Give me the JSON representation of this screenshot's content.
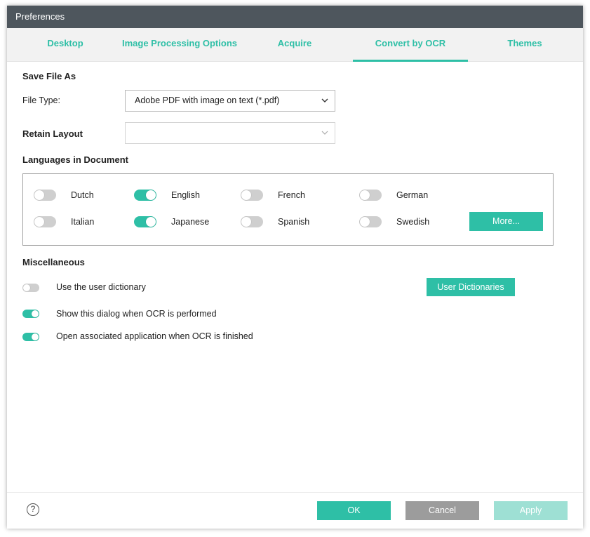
{
  "window": {
    "title": "Preferences"
  },
  "tabs": [
    {
      "label": "Desktop"
    },
    {
      "label": "Image Processing Options"
    },
    {
      "label": "Acquire"
    },
    {
      "label": "Convert by OCR"
    },
    {
      "label": "Themes"
    }
  ],
  "active_tab": "Convert by OCR",
  "save_file_as": {
    "title": "Save File As",
    "file_type_label": "File Type:",
    "file_type_value": "Adobe PDF with image on text (*.pdf)",
    "retain_layout_label": "Retain Layout",
    "retain_layout_value": ""
  },
  "languages": {
    "title": "Languages in Document",
    "items": [
      {
        "label": "Dutch",
        "on": false
      },
      {
        "label": "English",
        "on": true
      },
      {
        "label": "French",
        "on": false
      },
      {
        "label": "German",
        "on": false
      },
      {
        "label": "Italian",
        "on": false
      },
      {
        "label": "Japanese",
        "on": true
      },
      {
        "label": "Spanish",
        "on": false
      },
      {
        "label": "Swedish",
        "on": false
      }
    ],
    "more_button": "More..."
  },
  "misc": {
    "title": "Miscellaneous",
    "items": [
      {
        "label": "Use the user dictionary",
        "on": false
      },
      {
        "label": "Show this dialog when OCR is performed",
        "on": true
      },
      {
        "label": "Open associated application when OCR is finished",
        "on": true
      }
    ],
    "user_dictionaries_button": "User Dictionaries"
  },
  "footer": {
    "help_icon": "question-circle-icon",
    "help_glyph": "?",
    "ok": "OK",
    "cancel": "Cancel",
    "apply": "Apply"
  },
  "colors": {
    "accent": "#2ebfa6",
    "titlebar": "#4e565d",
    "cancel": "#9c9c9c",
    "apply_disabled": "#9ee0d4"
  }
}
